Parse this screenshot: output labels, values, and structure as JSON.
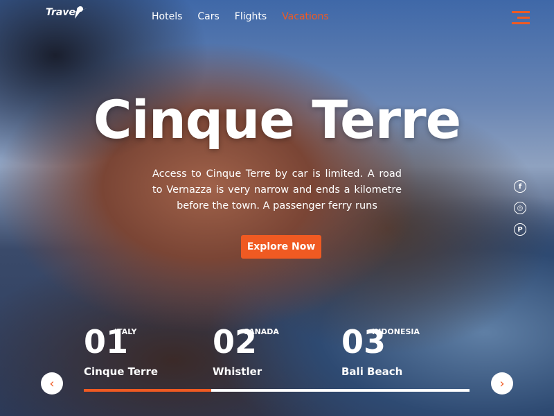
{
  "brand": {
    "logo_text": "Travel"
  },
  "nav": {
    "items": [
      {
        "label": "Hotels"
      },
      {
        "label": "Cars"
      },
      {
        "label": "Flights"
      },
      {
        "label": "Vacations",
        "active": true
      }
    ]
  },
  "hero": {
    "title": "Cinque Terre",
    "description": "Access to Cinque Terre by car is limited. A road to Vernazza is very narrow and ends a kilometre before the town. A passenger ferry runs",
    "cta": "Explore Now"
  },
  "social": [
    {
      "icon": "facebook-icon",
      "glyph": "f"
    },
    {
      "icon": "instagram-icon",
      "glyph": "◎"
    },
    {
      "icon": "pinterest-icon",
      "glyph": "P"
    }
  ],
  "slides": [
    {
      "number": "01",
      "country": "ITALY",
      "name": "Cinque Terre"
    },
    {
      "number": "02",
      "country": "CANADA",
      "name": "Whistler"
    },
    {
      "number": "03",
      "country": "INDONESIA",
      "name": "Bali Beach"
    }
  ],
  "progress_percent": 33,
  "arrows": {
    "prev": "‹",
    "next": "›"
  },
  "colors": {
    "accent": "#f05a22"
  }
}
